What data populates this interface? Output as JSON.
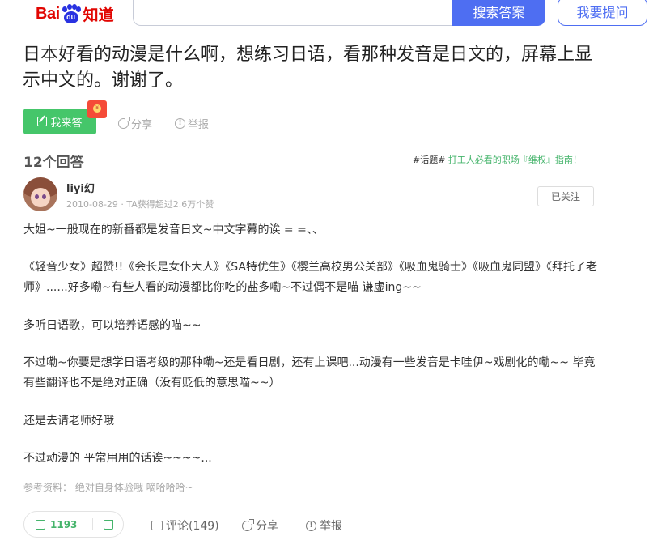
{
  "header": {
    "logo_text_bai": "Bai",
    "logo_text_du": "du",
    "logo_text_zhidao": "知道",
    "search_placeholder": "",
    "search_button": "搜索答案",
    "ask_button": "我要提问"
  },
  "question": {
    "title": "日本好看的动漫是什么啊，想练习日语，看那种发音是日文的，屏幕上显示中文的。谢谢了。",
    "answer_button": "我来答",
    "share": "分享",
    "report": "举报"
  },
  "answers_summary": {
    "count_label": "12个回答",
    "topic_hash": "#话题#",
    "topic_text": " 打工人必看的职场『维权』指南！"
  },
  "answer": {
    "username": "liyi幻",
    "meta": "2010-08-29 · TA获得超过2.6万个赞",
    "follow_button": "已关注",
    "paragraphs": [
      "大姐~一般现在的新番都是发音日文~中文字幕的诶 = =、、",
      "《轻音少女》超赞!!《会长是女仆大人》《SA特优生》《樱兰高校男公关部》《吸血鬼骑士》《吸血鬼同盟》《拜托了老师》......好多嘞~有些人看的动漫都比你吃的盐多嘞~不过偶不是喵 谦虚ing~~",
      "多听日语歌，可以培养语感的喵~~",
      "不过嘞~你要是想学日语考级的那种嘞~还是看日剧，还有上课吧...动漫有一些发音是卡哇伊~戏剧化的嘞~~ 毕竟有些翻译也不是绝对正确（没有贬低的意思喵~~）",
      "还是去请老师好哦",
      "不过动漫的 平常用用的话诶~~~~..."
    ],
    "reference": "参考资料： 绝对自身体验哦 嘀哈哈哈~",
    "likes": "1193",
    "comments": "评论(149)",
    "share": "分享",
    "report": "举报"
  },
  "colors": {
    "brand_red": "#e10602",
    "brand_blue": "#4e6ef2",
    "green": "#45c66a"
  }
}
